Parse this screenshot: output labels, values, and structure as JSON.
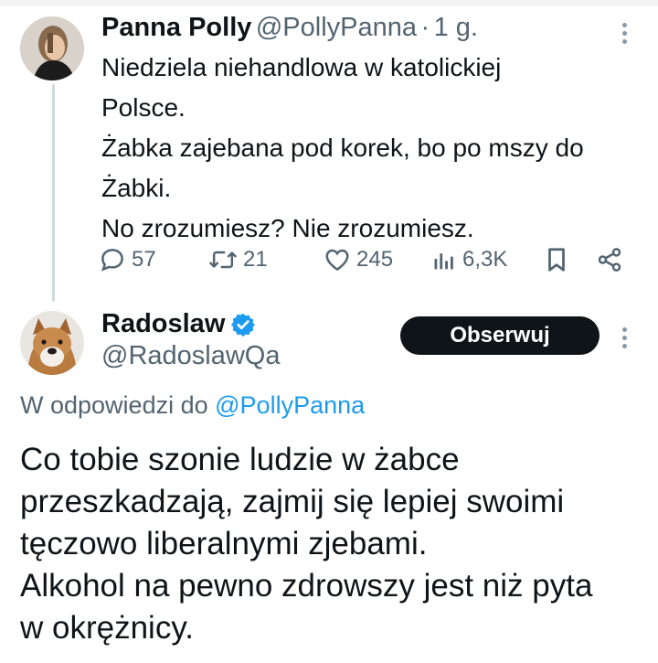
{
  "tweet1": {
    "author_name": "Panna Polly",
    "author_handle": "@PollyPanna",
    "separator": "·",
    "time": "1 g.",
    "text_lines": [
      "Niedziela niehandlowa w katolickiej",
      "Polsce.",
      "Żabka zajebana pod korek, bo po mszy do",
      "Żabki.",
      "No zrozumiesz? Nie zrozumiesz."
    ],
    "stats": {
      "replies": "57",
      "retweets": "21",
      "likes": "245",
      "views": "6,3K"
    },
    "icons": [
      "reply-icon",
      "retweet-icon",
      "like-icon",
      "views-icon",
      "bookmark-icon",
      "share-icon",
      "more-icon"
    ]
  },
  "tweet2": {
    "author_name": "Radoslaw",
    "author_handle": "@RadoslawQa",
    "verified": true,
    "follow_label": "Obserwuj",
    "reply_prefix": "W odpowiedzi do",
    "reply_to": "@PollyPanna",
    "text_lines": [
      "Co tobie szonie ludzie w żabce",
      "przeszkadzają, zajmij się lepiej swoimi",
      "tęczowo liberalnymi zjebami.",
      "Alkohol na pewno zdrowszy jest niż pyta",
      "w okrężnicy."
    ]
  },
  "colors": {
    "text": "#0f1419",
    "secondary": "#536471",
    "link": "#1d9bf0",
    "verified": "#1d9bf0",
    "button_bg": "#0f1419",
    "thread_line": "#cfd9de"
  }
}
